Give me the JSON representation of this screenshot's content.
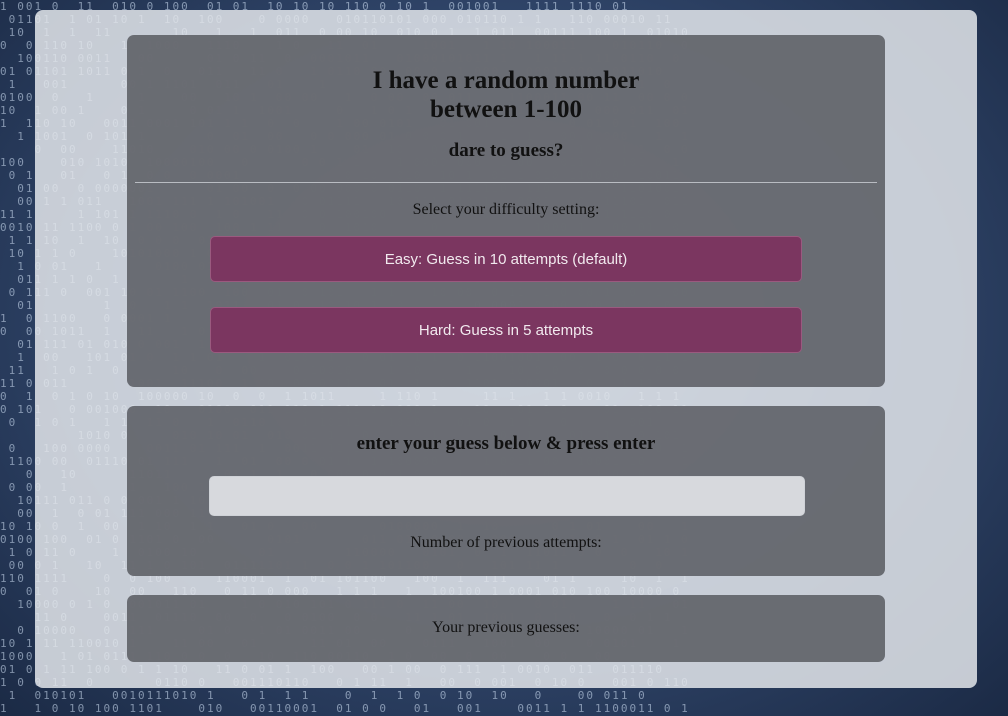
{
  "game": {
    "title_line1": "I have a random number",
    "title_line2": "between 1-100",
    "subtitle": "dare to guess?"
  },
  "difficulty": {
    "label": "Select your difficulty setting:",
    "easy_label": "Easy: Guess in 10 attempts (default)",
    "hard_label": "Hard: Guess in 5 attempts"
  },
  "guess": {
    "heading": "enter your guess below & press enter",
    "input_value": "",
    "attempts_label": "Number of previous attempts:"
  },
  "history": {
    "label": "Your previous guesses:"
  },
  "colors": {
    "button_bg": "#7b3660",
    "card_bg": "#62646a",
    "frame_bg": "#e2e5ea",
    "backdrop": "#2f4468"
  }
}
